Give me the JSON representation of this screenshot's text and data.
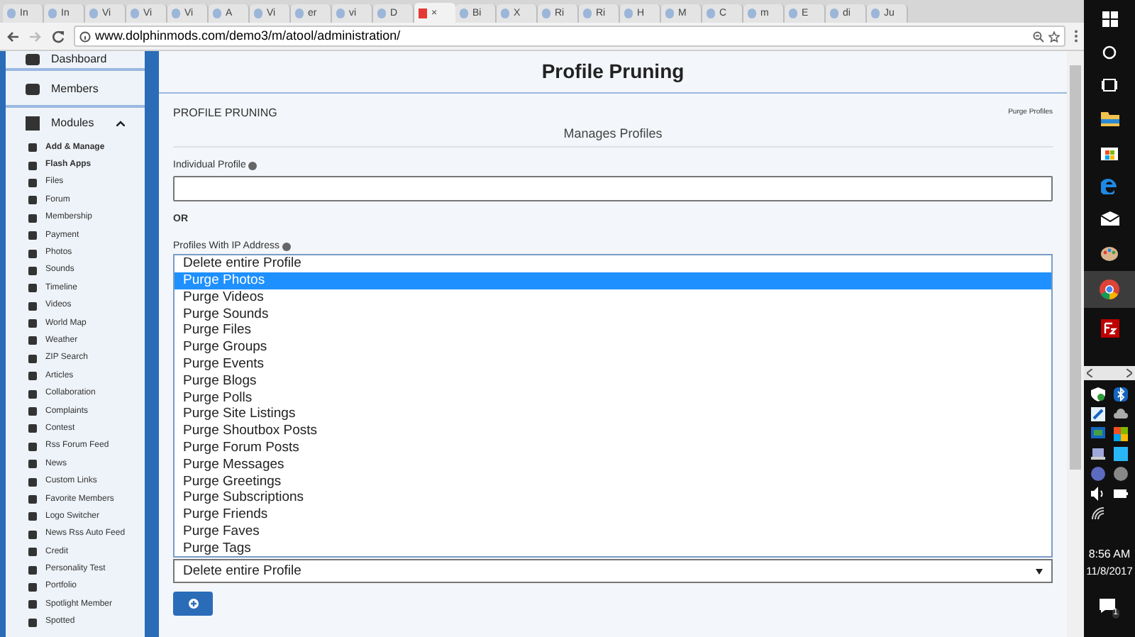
{
  "browser": {
    "tabs": [
      {
        "label": "In",
        "selected": false
      },
      {
        "label": "In",
        "selected": false
      },
      {
        "label": "Vi",
        "selected": false
      },
      {
        "label": "Vi",
        "selected": false
      },
      {
        "label": "Vi",
        "selected": false
      },
      {
        "label": "A",
        "selected": false
      },
      {
        "label": "Vi",
        "selected": false
      },
      {
        "label": "er",
        "selected": false
      },
      {
        "label": "vi",
        "selected": false
      },
      {
        "label": "D",
        "selected": false
      },
      {
        "label": "×",
        "selected": true
      },
      {
        "label": "Bi",
        "selected": false
      },
      {
        "label": "X",
        "selected": false
      },
      {
        "label": "Ri",
        "selected": false
      },
      {
        "label": "Ri",
        "selected": false
      },
      {
        "label": "H",
        "selected": false
      },
      {
        "label": "M",
        "selected": false
      },
      {
        "label": "C",
        "selected": false
      },
      {
        "label": "m",
        "selected": false
      },
      {
        "label": "E",
        "selected": false
      },
      {
        "label": "di",
        "selected": false
      },
      {
        "label": "Ju",
        "selected": false
      }
    ],
    "url": {
      "domain": "www.dolphinmods.com",
      "path": "/demo3/m/atool/administration/"
    }
  },
  "sidebar": {
    "top_items": [
      "Dashboard",
      "Members"
    ],
    "section": {
      "label": "Modules",
      "expanded": true
    },
    "items": [
      {
        "label": "Add & Manage",
        "bold": true
      },
      {
        "label": "Flash Apps",
        "bold": true
      },
      {
        "label": "Files",
        "bold": false
      },
      {
        "label": "Forum",
        "bold": false
      },
      {
        "label": "Membership",
        "bold": false
      },
      {
        "label": "Payment",
        "bold": false
      },
      {
        "label": "Photos",
        "bold": false
      },
      {
        "label": "Sounds",
        "bold": false
      },
      {
        "label": "Timeline",
        "bold": false
      },
      {
        "label": "Videos",
        "bold": false
      },
      {
        "label": "World Map",
        "bold": false
      },
      {
        "label": "Weather",
        "bold": false
      },
      {
        "label": "ZIP Search",
        "bold": false
      },
      {
        "label": "Articles",
        "bold": false
      },
      {
        "label": "Collaboration",
        "bold": false
      },
      {
        "label": "Complaints",
        "bold": false
      },
      {
        "label": "Contest",
        "bold": false
      },
      {
        "label": "Rss Forum Feed",
        "bold": false
      },
      {
        "label": "News",
        "bold": false
      },
      {
        "label": "Custom Links",
        "bold": false
      },
      {
        "label": "Favorite Members",
        "bold": false
      },
      {
        "label": "Logo Switcher",
        "bold": false
      },
      {
        "label": "News Rss Auto Feed",
        "bold": false
      },
      {
        "label": "Credit",
        "bold": false
      },
      {
        "label": "Personality Test",
        "bold": false
      },
      {
        "label": "Portfolio",
        "bold": false
      },
      {
        "label": "Spotlight Member",
        "bold": false
      },
      {
        "label": "Spotted",
        "bold": false
      }
    ]
  },
  "page": {
    "title": "Profile Pruning",
    "panel": {
      "heading": "PROFILE PRUNING",
      "link": "Purge Profiles",
      "subtitle": "Manages Profiles",
      "individual_label": "Individual Profile",
      "or_text": "OR",
      "ip_label": "Profiles With IP Address",
      "options": [
        {
          "label": "Delete entire Profile",
          "selected": false
        },
        {
          "label": "Purge Photos",
          "selected": true
        },
        {
          "label": "Purge Videos",
          "selected": false
        },
        {
          "label": "Purge Sounds",
          "selected": false
        },
        {
          "label": "Purge Files",
          "selected": false
        },
        {
          "label": "Purge Groups",
          "selected": false
        },
        {
          "label": "Purge Events",
          "selected": false
        },
        {
          "label": "Purge Blogs",
          "selected": false
        },
        {
          "label": "Purge Polls",
          "selected": false
        },
        {
          "label": "Purge Site Listings",
          "selected": false
        },
        {
          "label": "Purge Shoutbox Posts",
          "selected": false
        },
        {
          "label": "Purge Forum Posts",
          "selected": false
        },
        {
          "label": "Purge Messages",
          "selected": false
        },
        {
          "label": "Purge Greetings",
          "selected": false
        },
        {
          "label": "Purge Subscriptions",
          "selected": false
        },
        {
          "label": "Purge Friends",
          "selected": false
        },
        {
          "label": "Purge Faves",
          "selected": false
        },
        {
          "label": "Purge Tags",
          "selected": false
        }
      ],
      "select_value": "Delete entire Profile"
    }
  },
  "taskbar": {
    "time": "8:56 AM",
    "date": "11/8/2017",
    "notification_count": "1"
  }
}
